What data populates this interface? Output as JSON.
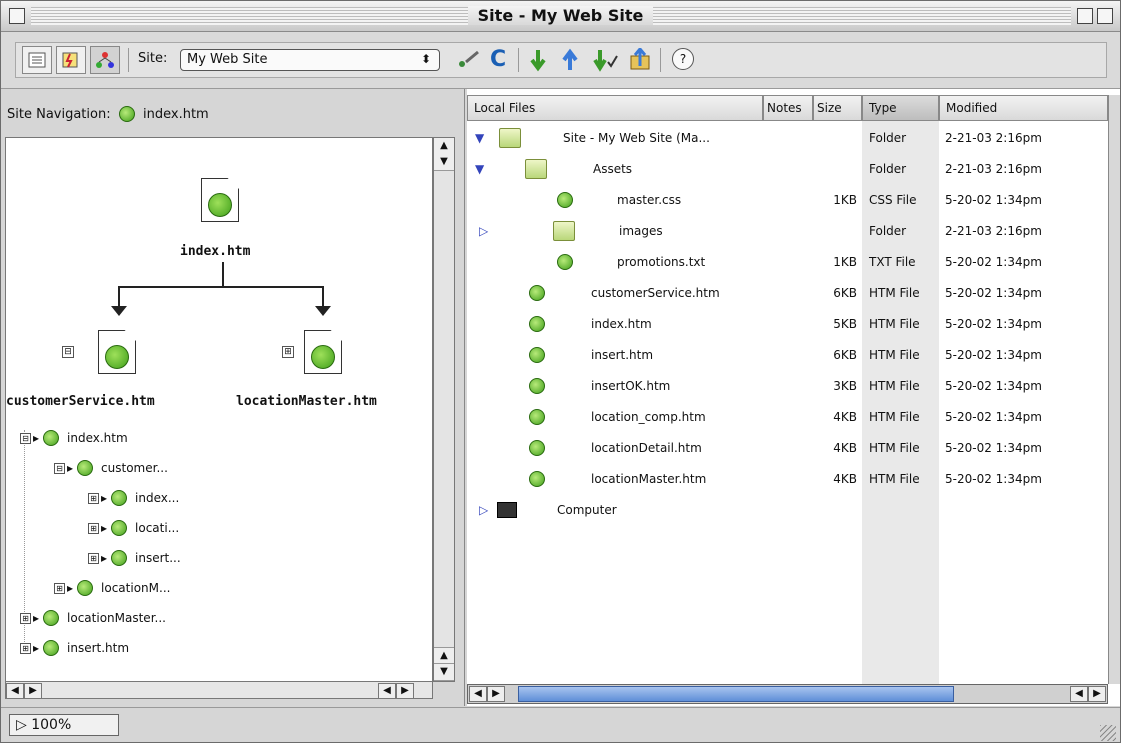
{
  "window": {
    "title": "Site - My Web Site"
  },
  "toolbar": {
    "site_label": "Site:",
    "site_value": "My Web Site",
    "site_arrow": "⬍",
    "refresh_glyph": "C",
    "help_glyph": "?",
    "icons": [
      "list-view-icon",
      "site-files-icon",
      "site-map-icon",
      "connect-icon",
      "refresh-icon",
      "get-icon",
      "put-icon",
      "check-in-icon",
      "check-out-icon",
      "help-icon"
    ]
  },
  "nav": {
    "label": "Site Navigation:",
    "file": "index.htm"
  },
  "map": {
    "root": "index.htm",
    "children": [
      "customerService.htm",
      "locationMaster.htm"
    ],
    "expand_minus": "⊟",
    "expand_plus": "⊞",
    "tree": [
      {
        "box": "⊟",
        "label": "index.htm"
      },
      {
        "box": "⊟",
        "label": "customer..."
      },
      {
        "box": "⊞",
        "label": "index..."
      },
      {
        "box": "⊞",
        "label": "locati..."
      },
      {
        "box": "⊞",
        "label": "insert..."
      },
      {
        "box": "⊞",
        "label": "locationM..."
      },
      {
        "box": "⊞",
        "label": "locationMaster..."
      },
      {
        "box": "⊞",
        "label": "insert.htm"
      }
    ]
  },
  "files": {
    "columns": [
      "Local Files",
      "Notes",
      "Size",
      "Type",
      "Modified"
    ],
    "rows": [
      {
        "name": "Site - My Web Site (Ma...",
        "size": "",
        "type": "Folder",
        "modified": "2-21-03 2:16pm"
      },
      {
        "name": "Assets",
        "size": "",
        "type": "Folder",
        "modified": "2-21-03 2:16pm"
      },
      {
        "name": "master.css",
        "size": "1KB",
        "type": "CSS File",
        "modified": "5-20-02 1:34pm"
      },
      {
        "name": "images",
        "size": "",
        "type": "Folder",
        "modified": "2-21-03 2:16pm"
      },
      {
        "name": "promotions.txt",
        "size": "1KB",
        "type": "TXT File",
        "modified": "5-20-02 1:34pm"
      },
      {
        "name": "customerService.htm",
        "size": "6KB",
        "type": "HTM File",
        "modified": "5-20-02 1:34pm"
      },
      {
        "name": "index.htm",
        "size": "5KB",
        "type": "HTM File",
        "modified": "5-20-02 1:34pm"
      },
      {
        "name": "insert.htm",
        "size": "6KB",
        "type": "HTM File",
        "modified": "5-20-02 1:34pm"
      },
      {
        "name": "insertOK.htm",
        "size": "3KB",
        "type": "HTM File",
        "modified": "5-20-02 1:34pm"
      },
      {
        "name": "location_comp.htm",
        "size": "4KB",
        "type": "HTM File",
        "modified": "5-20-02 1:34pm"
      },
      {
        "name": "locationDetail.htm",
        "size": "4KB",
        "type": "HTM File",
        "modified": "5-20-02 1:34pm"
      },
      {
        "name": "locationMaster.htm",
        "size": "4KB",
        "type": "HTM File",
        "modified": "5-20-02 1:34pm"
      },
      {
        "name": "Computer",
        "size": "",
        "type": "",
        "modified": ""
      }
    ]
  },
  "status": {
    "zoom": "100%"
  },
  "colors": {
    "scroll_thumb": "#5f8fd8",
    "dw_green": "#3f9f1a"
  }
}
